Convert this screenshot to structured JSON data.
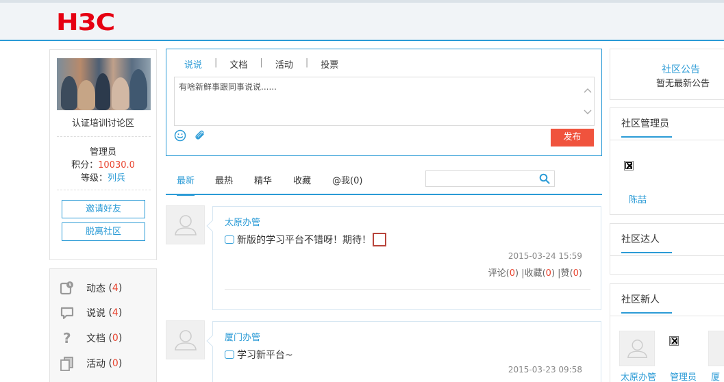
{
  "header": {
    "logo_text": "H3C"
  },
  "profile": {
    "community_name": "认证培训讨论区",
    "role": "管理员",
    "points_label": "积分：",
    "points_value": "10030.0",
    "level_label": "等级：",
    "level_value": "列兵",
    "invite_button": "邀请好友",
    "leave_button": "脱离社区"
  },
  "menu": [
    {
      "label": "动态",
      "count": "4",
      "icon": "dynamic-icon"
    },
    {
      "label": "说说",
      "count": "4",
      "icon": "chat-bubble-icon"
    },
    {
      "label": "文档",
      "count": "0",
      "icon": "question-icon"
    },
    {
      "label": "活动",
      "count": "0",
      "icon": "documents-icon"
    }
  ],
  "menu_labels": {
    "0": {
      "open": "(",
      "close": ")"
    }
  },
  "composer": {
    "tabs": [
      "说说",
      "文档",
      "活动",
      "投票"
    ],
    "separator": "|",
    "placeholder": "有啥新鲜事跟同事说说......",
    "publish_button": "发布"
  },
  "feed_tabs": [
    "最新",
    "最热",
    "精华",
    "收藏",
    "@我(0)"
  ],
  "posts": [
    {
      "author": "太原办管",
      "content": "新版的学习平台不错呀！期待！",
      "time": "2015-03-24 15:59",
      "comment_label": "评论",
      "comment_count": "0",
      "fav_label": "|收藏",
      "fav_count": "0",
      "like_label": "|赞",
      "like_count": "0"
    },
    {
      "author": "厦门办管",
      "content": "学习新平台~",
      "time": "2015-03-23 09:58"
    }
  ],
  "right": {
    "notice_title": "社区公告",
    "notice_text": "暂无最新公告",
    "admins_title": "社区管理员",
    "admin_name": "陈喆",
    "experts_title": "社区达人",
    "newbies_title": "社区新人",
    "newbie_1": "太原办管",
    "newbie_2": "管理员",
    "newbie_3": "厦门"
  },
  "colors": {
    "accent": "#2b9bd6",
    "brand_red": "#e60012",
    "publish": "#f0533d",
    "count_red": "#e8432e"
  }
}
